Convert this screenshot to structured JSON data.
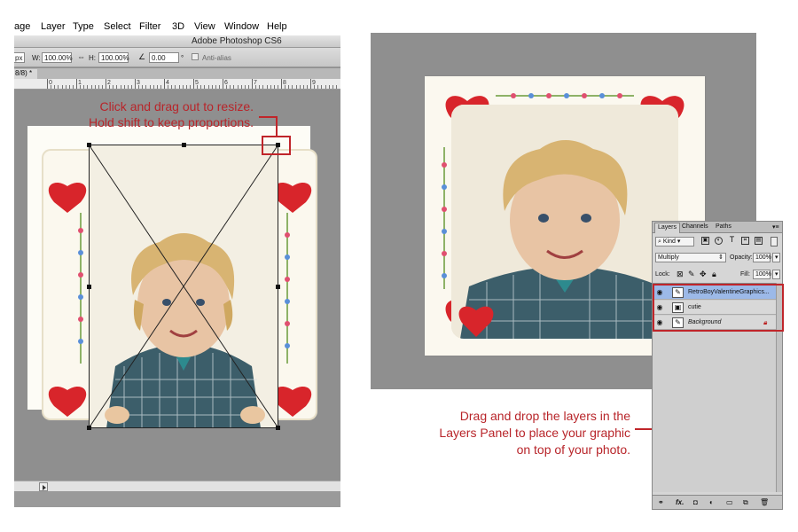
{
  "menu": [
    "age",
    "Layer",
    "Type",
    "Select",
    "Filter",
    "3D",
    "View",
    "Window",
    "Help"
  ],
  "window_title": "Adobe Photoshop CS6",
  "options_bar": {
    "unit_label": "px",
    "w_label": "W:",
    "w_value": "100.00%",
    "h_label": "H:",
    "h_value": "100.00%",
    "angle_value": "0.00",
    "degree_symbol": "°",
    "anti_alias_label": "Anti-alias"
  },
  "doc_tab": "8/8) *",
  "ruler_numbers": [
    "0",
    "1",
    "2",
    "3",
    "4",
    "5",
    "6",
    "7",
    "8",
    "9"
  ],
  "callout_resize": [
    "Click and drag out to resize.",
    "Hold shift to keep proportions."
  ],
  "callout_layers": [
    "Drag and drop the layers in the",
    "Layers Panel to place your graphic",
    "on top of your photo."
  ],
  "layers_panel": {
    "tabs": [
      "Layers",
      "Channels",
      "Paths"
    ],
    "kind_label": "Kind",
    "blend_mode": "Multiply",
    "opacity_label": "Opacity:",
    "opacity_value": "100%",
    "lock_label": "Lock:",
    "fill_label": "Fill:",
    "fill_value": "100%",
    "layers": [
      {
        "name": "RetroBoyValentineGraphics...",
        "selected": true
      },
      {
        "name": "cutie",
        "selected": false
      },
      {
        "name": "Background",
        "selected": false,
        "locked": true
      }
    ],
    "bottom_icons": [
      "link-icon",
      "fx-icon",
      "mask-icon",
      "adjustment-icon",
      "folder-icon",
      "new-layer-icon",
      "trash-icon"
    ],
    "fx_label": "fx."
  },
  "colors": {
    "accent_red": "#c0252a",
    "canvas_grey": "#8f8f8f",
    "layer_selected": "#9cb9e8"
  }
}
